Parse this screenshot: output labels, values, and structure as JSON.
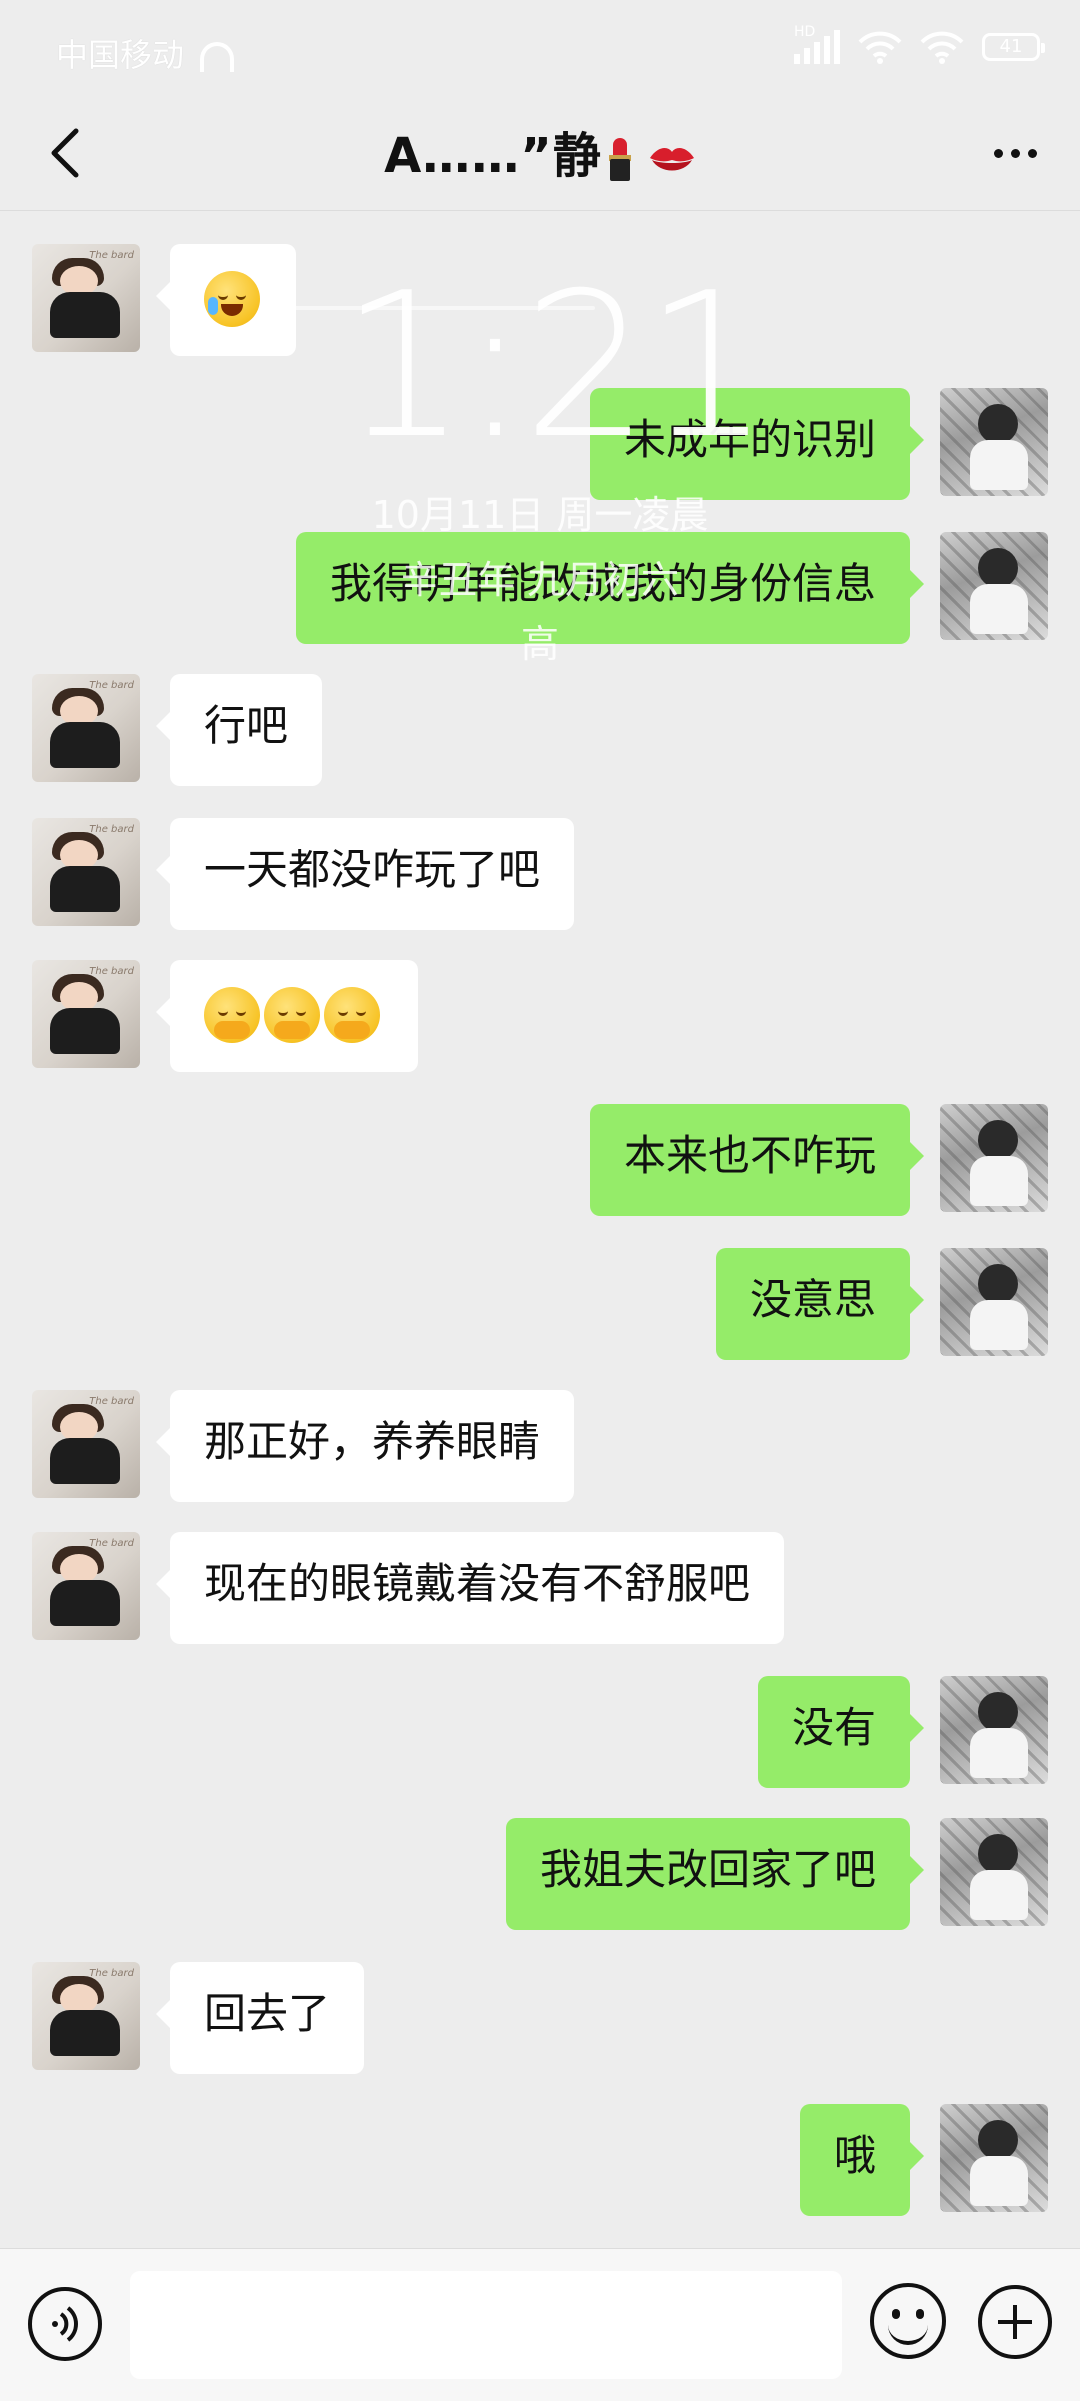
{
  "status_bar": {
    "carrier": "中国移动",
    "battery": "41",
    "network_badge": "HD"
  },
  "header": {
    "title": "A……”静",
    "back_icon": "chevron-left-icon",
    "more_icon": "more-dots-icon"
  },
  "overlay": {
    "time": "1:21",
    "date": "10月11日 周一凌晨",
    "lunar": "辛丑年 九月初六",
    "extra": "高"
  },
  "messages": [
    {
      "side": "left",
      "text": "",
      "emoji": "crying-face"
    },
    {
      "side": "right",
      "text": "未成年的识别"
    },
    {
      "side": "right",
      "text": "我得明年能改成我的身份信息"
    },
    {
      "side": "left",
      "text": "行吧"
    },
    {
      "side": "left",
      "text": "一天都没咋玩了吧"
    },
    {
      "side": "left",
      "text": "",
      "emoji": "face-with-hand-over-mouth x3"
    },
    {
      "side": "right",
      "text": "本来也不咋玩"
    },
    {
      "side": "right",
      "text": "没意思"
    },
    {
      "side": "left",
      "text": "那正好，养养眼睛"
    },
    {
      "side": "left",
      "text": "现在的眼镜戴着没有不舒服吧"
    },
    {
      "side": "right",
      "text": "没有"
    },
    {
      "side": "right",
      "text": "我姐夫改回家了吧"
    },
    {
      "side": "left",
      "text": "回去了"
    },
    {
      "side": "right",
      "text": "哦"
    }
  ],
  "input_bar": {
    "voice_icon": "voice-icon",
    "emoji_icon": "emoji-icon",
    "plus_icon": "plus-icon",
    "input_value": ""
  },
  "colors": {
    "background": "#ededed",
    "bubble_self": "#95ec69",
    "bubble_other": "#ffffff"
  }
}
